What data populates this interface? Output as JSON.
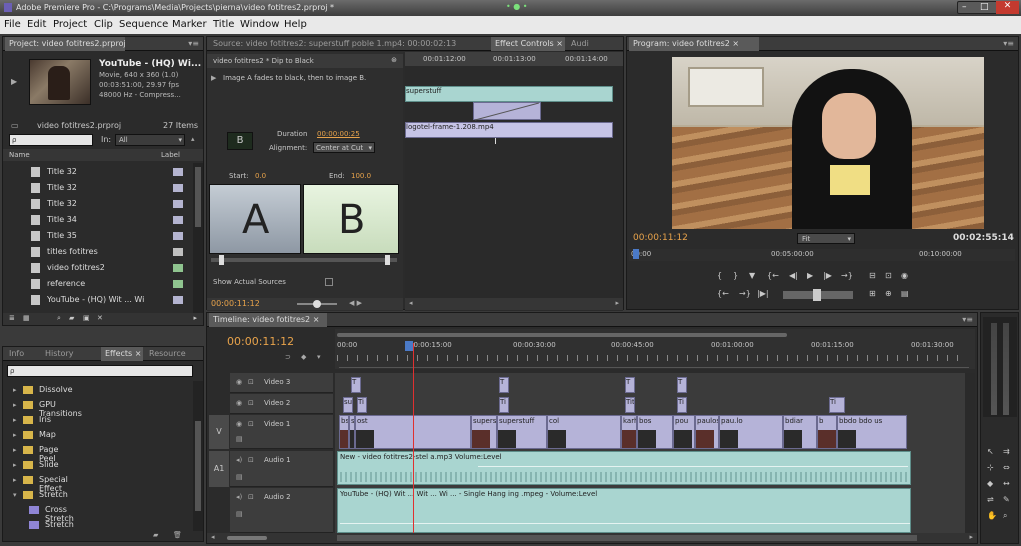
{
  "window": {
    "title": "Adobe Premiere Pro - C:\\Programs\\Media\\Projects\\pierna\\video fotitres2.prproj *",
    "min": "–",
    "max": "□",
    "close": "✕",
    "dots": "• ● •"
  },
  "menu": [
    "File",
    "Edit",
    "Project",
    "Clip",
    "Sequence",
    "Marker",
    "Title",
    "Window",
    "Help"
  ],
  "project": {
    "tab": "Project: video fotitres2.prproj ×",
    "clip_name": "YouTube - (HQ) Wi...",
    "clip_info": [
      "Movie, 640 x 360 (1.0)",
      "00:03:51:00, 29.97 fps",
      "48000 Hz - Compress..."
    ],
    "project_name": "video fotitres2.prproj",
    "item_count": "27 Items",
    "search_placeholder": "ρ",
    "in_label": "In:",
    "in_value": "All",
    "col_name": "Name",
    "col_label": "Label",
    "items": [
      {
        "label": "Title 32",
        "color": "#b4b4d0"
      },
      {
        "label": "Title 32",
        "color": "#b4b4d0"
      },
      {
        "label": "Title 32",
        "color": "#b4b4d0"
      },
      {
        "label": "Title 34",
        "color": "#b4b4d0"
      },
      {
        "label": "Title 35",
        "color": "#b4b4d0"
      },
      {
        "label": "titles fotitres",
        "color": "#c0c0c0"
      },
      {
        "label": "video fotitres2",
        "color": "#8fc48f"
      },
      {
        "label": "reference",
        "color": "#8fc48f"
      },
      {
        "label": "YouTube - (HQ) Wit ... Wi",
        "color": "#b4b4d0"
      }
    ]
  },
  "effects": {
    "tabs": [
      "Info",
      "History",
      "Effects ×",
      "Resource"
    ],
    "search_placeholder": "ρ",
    "items": [
      {
        "label": "Dissolve",
        "type": "folder",
        "open": false
      },
      {
        "label": "GPU Transitions",
        "type": "folder",
        "open": false
      },
      {
        "label": "Iris",
        "type": "folder",
        "open": false
      },
      {
        "label": "Map",
        "type": "folder",
        "open": false
      },
      {
        "label": "Page Peel",
        "type": "folder",
        "open": false
      },
      {
        "label": "Slide",
        "type": "folder",
        "open": false
      },
      {
        "label": "Special Effect",
        "type": "folder",
        "open": false
      },
      {
        "label": "Stretch",
        "type": "folder",
        "open": true
      },
      {
        "label": "Cross Stretch",
        "type": "effect",
        "open": false
      },
      {
        "label": "Stretch",
        "type": "effect",
        "open": false
      }
    ]
  },
  "source": {
    "tabs": [
      "Source: video fotitres2: superstuff poble 1.mp4: 00:00:02:13",
      "Effect Controls ×",
      "Audi"
    ],
    "transition_name": "Dip to Black",
    "header_label": "video fotitres2 * Dip to Black",
    "description": "Image A fades to black, then to image B.",
    "duration_label": "Duration",
    "duration_value": "00:00:00:25",
    "alignment_label": "Alignment:",
    "alignment_value": "Center at Cut",
    "start_label": "Start:",
    "start_value": "0.0",
    "end_label": "End:",
    "end_value": "100.0",
    "a_label": "A",
    "b_label": "B",
    "show_actual": "Show Actual Sources",
    "timecode": "00:00:11:12",
    "ruler": [
      "00:01:12:00",
      "00:01:13:00",
      "00:01:14:00"
    ],
    "clip_a": "superstuff",
    "clip_b": "logotel-frame-1.208.mp4"
  },
  "program": {
    "tab": "Program: video fotitres2 ×",
    "timecode_left": "00:00:11:12",
    "fit": "Fit",
    "timecode_right": "00:02:55:14",
    "ruler": [
      "00:00",
      "00:05:00:00",
      "00:10:00:00"
    ]
  },
  "timeline": {
    "tab": "Timeline: video fotitres2 ×",
    "timecode": "00:00:11:12",
    "ruler": [
      "00:00",
      "00:00:15:00",
      "00:00:30:00",
      "00:00:45:00",
      "00:01:00:00",
      "00:01:15:00",
      "00:01:30:00"
    ],
    "tracks": [
      {
        "name": "Video 3",
        "kind": "video"
      },
      {
        "name": "Video 2",
        "kind": "video"
      },
      {
        "name": "Video 1",
        "kind": "video"
      },
      {
        "name": "Audio 1",
        "kind": "audio"
      },
      {
        "name": "Audio 2",
        "kind": "audio"
      }
    ],
    "v_label": "V",
    "a1_label": "A1",
    "v1_clips": [
      {
        "label": "bs"
      },
      {
        "label": "superstuff poble 1.mpg Opacity"
      },
      {
        "label": "ost"
      },
      {
        "label": "superstuff lwsr"
      },
      {
        "label": "superstuff"
      },
      {
        "label": "col"
      },
      {
        "label": "karhs"
      },
      {
        "label": "bos"
      },
      {
        "label": "pou"
      },
      {
        "label": "paulos.mpg Op"
      },
      {
        "label": "pau.lo"
      },
      {
        "label": "bdiar"
      },
      {
        "label": "b"
      },
      {
        "label": "bbdo bdo us"
      }
    ],
    "v3_clips": [
      {
        "label": "T"
      },
      {
        "label": "T"
      },
      {
        "label": "T"
      },
      {
        "label": "T"
      }
    ],
    "v2_clips": [
      {
        "label": "su"
      },
      {
        "label": "Ti"
      },
      {
        "label": "Ti"
      },
      {
        "label": "Tit"
      },
      {
        "label": "Ti"
      },
      {
        "label": "Ti"
      }
    ],
    "a1_clip": "New - video fotitres2-stel a.mp3 Volume:Level",
    "a2_clip": "YouTube - (HQ) Wit ... Wit ... Wi ... - Single Hang ing .mpeg - Volume:Level"
  }
}
